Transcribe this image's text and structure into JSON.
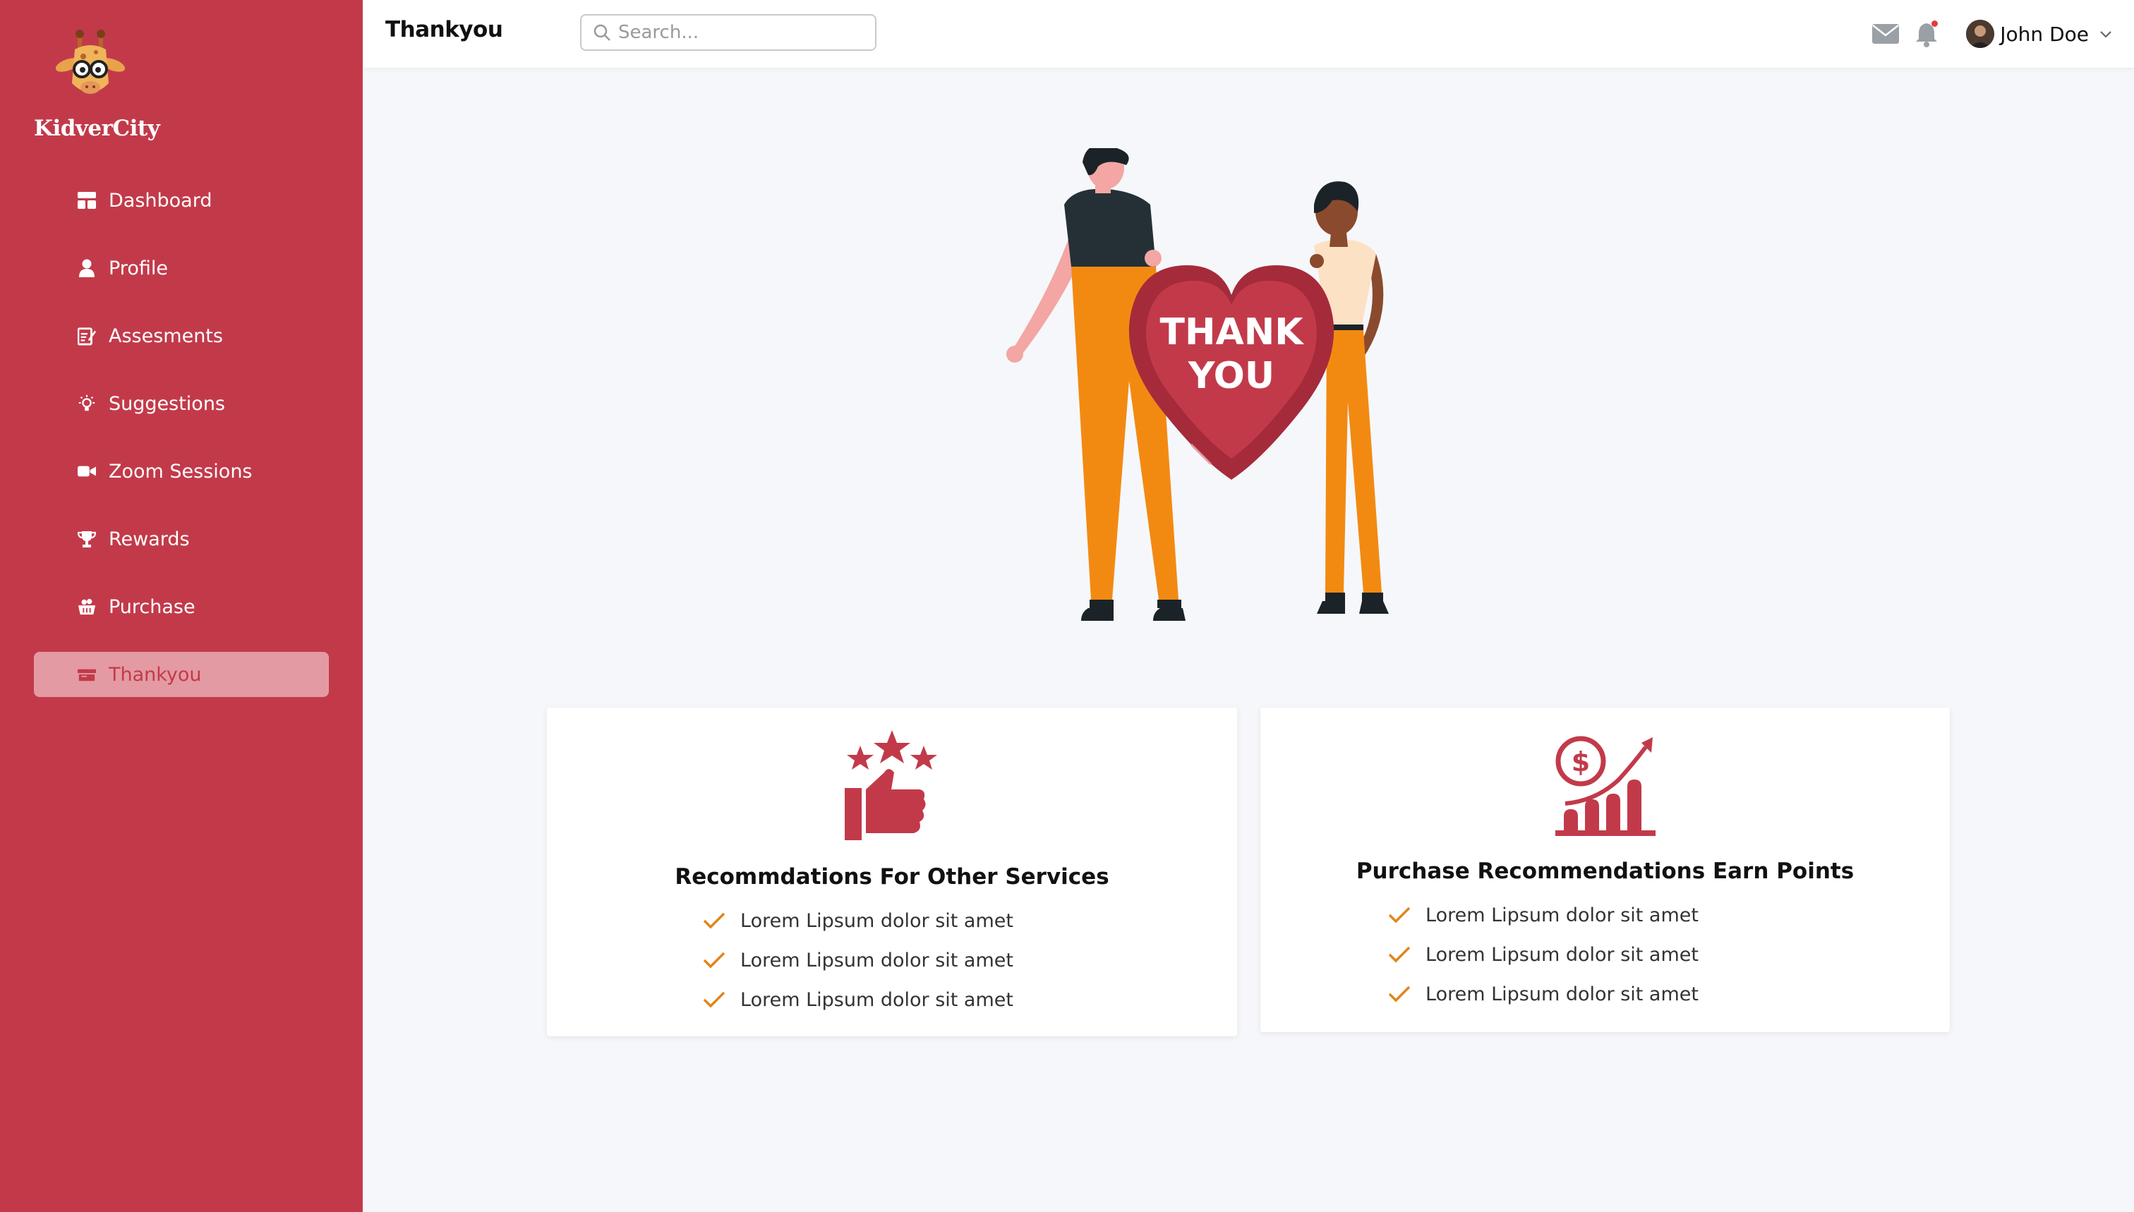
{
  "brand": {
    "name": "KidverCity"
  },
  "sidebar": {
    "items": [
      {
        "label": "Dashboard",
        "icon": "dashboard-icon"
      },
      {
        "label": "Profile",
        "icon": "user-icon"
      },
      {
        "label": "Assesments",
        "icon": "assessment-icon"
      },
      {
        "label": "Suggestions",
        "icon": "lightbulb-icon"
      },
      {
        "label": "Zoom Sessions",
        "icon": "video-icon"
      },
      {
        "label": "Rewards",
        "icon": "trophy-icon"
      },
      {
        "label": "Purchase",
        "icon": "basket-icon"
      },
      {
        "label": "Thankyou",
        "icon": "thankyou-icon",
        "active": true
      }
    ]
  },
  "header": {
    "title": "Thankyou",
    "search_placeholder": "Search...",
    "user_name": "John Doe",
    "notification_dot": true
  },
  "hero": {
    "heart_text_line1": "THANK",
    "heart_text_line2": "YOU"
  },
  "cards": [
    {
      "title": "Recommdations For Other Services",
      "icon": "thumbs-up-stars-icon",
      "items": [
        "Lorem Lipsum dolor sit amet",
        "Lorem Lipsum dolor sit amet",
        "Lorem Lipsum dolor sit amet"
      ]
    },
    {
      "title": "Purchase Recommendations Earn Points",
      "icon": "dollar-growth-chart-icon",
      "items": [
        "Lorem Lipsum dolor sit amet",
        "Lorem Lipsum dolor sit amet",
        "Lorem Lipsum dolor sit amet"
      ]
    }
  ],
  "colors": {
    "brand": "#c23a4a",
    "active_bg": "#e49aa2",
    "check": "#e0861a",
    "orange": "#f28a12"
  }
}
